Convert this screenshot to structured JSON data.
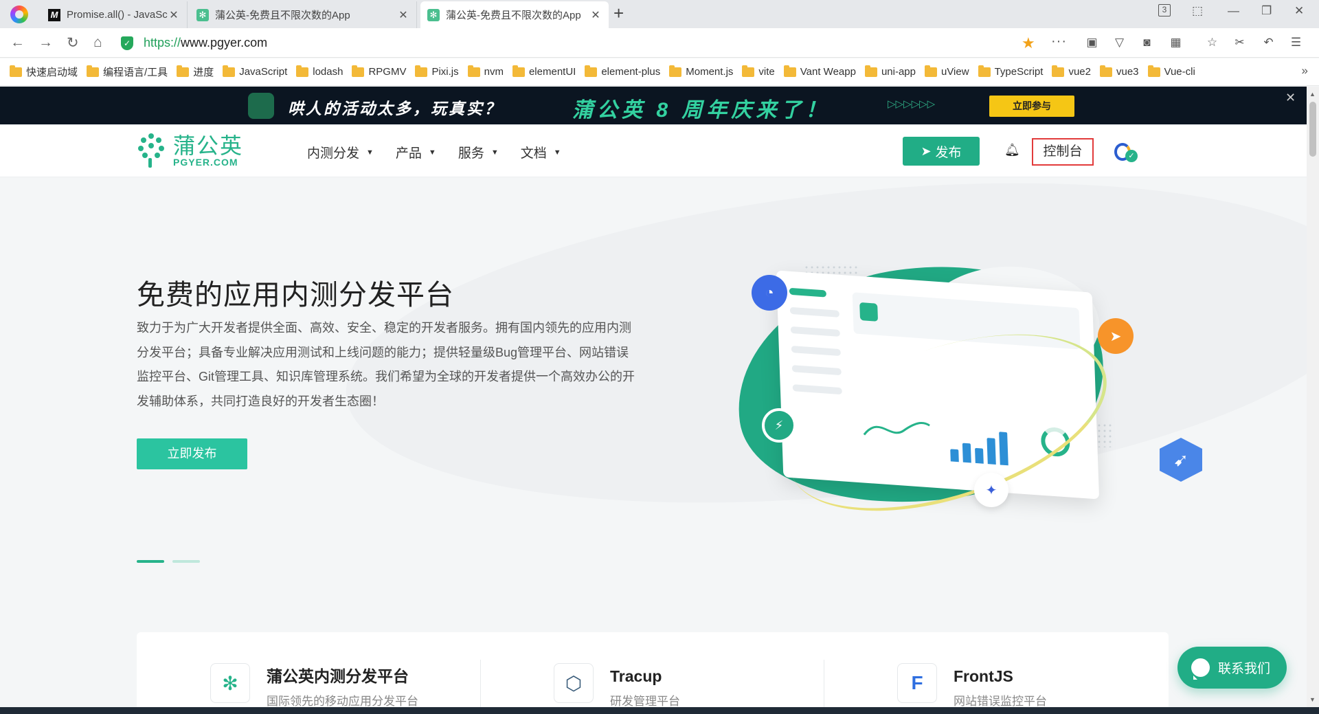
{
  "browser": {
    "tabs": [
      {
        "title": "Promise.all() - JavaScript | M",
        "favicon": "M"
      },
      {
        "title": "蒲公英-免费且不限次数的App",
        "favicon": "pgyer"
      },
      {
        "title": "蒲公英-免费且不限次数的App",
        "favicon": "pgyer",
        "active": true
      }
    ],
    "tab_counter": "3",
    "url_scheme": "https://",
    "url_host": "www.pgyer.com",
    "bookmarks": [
      "快速启动域",
      "编程语言/工具",
      "进度",
      "JavaScript",
      "lodash",
      "RPGMV",
      "Pixi.js",
      "nvm",
      "elementUI",
      "element-plus",
      "Moment.js",
      "vite",
      "Vant Weapp",
      "uni-app",
      "uView",
      "TypeScript",
      "vue2",
      "vue3",
      "Vue-cli"
    ],
    "bookmarks_more": "»"
  },
  "promo": {
    "text_left": "哄人的活动太多，玩真实？",
    "text_main": "蒲公英 8 周年庆来了！",
    "arrows": "▷▷▷▷▷▷",
    "cta": "立即参与",
    "close": "✕"
  },
  "header": {
    "brand_cn": "蒲公英",
    "brand_en": "PGYER.COM",
    "nav": [
      "内测分发",
      "产品",
      "服务",
      "文档"
    ],
    "publish": "发布",
    "console": "控制台"
  },
  "hero": {
    "title": "免费的应用内测分发平台",
    "description": "致力于为广大开发者提供全面、高效、安全、稳定的开发者服务。拥有国内领先的应用内测分发平台；具备专业解决应用测试和上线问题的能力；提供轻量级Bug管理平台、网站错误监控平台、Git管理工具、知识库管理系统。我们希望为全球的开发者提供一个高效办公的开发辅助体系，共同打造良好的开发者生态圈！",
    "cta": "立即发布",
    "carousel_active_index": 1,
    "carousel_count": 2
  },
  "products": [
    {
      "name": "蒲公英内测分发平台",
      "subtitle": "国际领先的移动应用分发平台",
      "icon": "pgyer-icon"
    },
    {
      "name": "Tracup",
      "subtitle": "研发管理平台",
      "icon": "cube-icon"
    },
    {
      "name": "FrontJS",
      "subtitle": "网站错误监控平台",
      "icon": "frontjs-icon"
    }
  ],
  "contact": {
    "label": "联系我们"
  },
  "colors": {
    "brand": "#21ad86",
    "promo_bg": "#0b1521",
    "promo_cta": "#f5c615",
    "console_outline": "#e23b3b"
  }
}
